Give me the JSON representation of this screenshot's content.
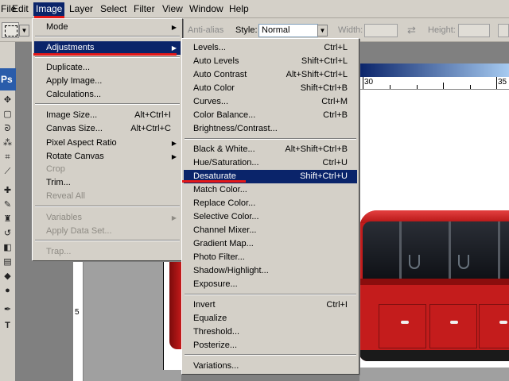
{
  "menubar": {
    "items": [
      "File",
      "Edit",
      "Image",
      "Layer",
      "Select",
      "Filter",
      "View",
      "Window",
      "Help"
    ],
    "active": "Image"
  },
  "options_bar": {
    "anti_alias_label": "Anti-alias",
    "style_label": "Style:",
    "style_value": "Normal",
    "width_label": "Width:",
    "height_label": "Height:"
  },
  "toolbox": {
    "logo_text": "Ps"
  },
  "rulers": {
    "top_numbers": [
      "30",
      "35"
    ],
    "left_numbers": [
      "5"
    ]
  },
  "image_menu": {
    "items": [
      {
        "label": "Mode",
        "submenu": true,
        "shortcut": "",
        "disabled": false
      },
      {
        "label": "Adjustments",
        "submenu": true,
        "shortcut": "",
        "disabled": false,
        "highlighted": true
      },
      {
        "label": "Duplicate...",
        "submenu": false,
        "shortcut": "",
        "disabled": false
      },
      {
        "label": "Apply Image...",
        "submenu": false,
        "shortcut": "",
        "disabled": false
      },
      {
        "label": "Calculations...",
        "submenu": false,
        "shortcut": "",
        "disabled": false
      },
      {
        "label": "Image Size...",
        "submenu": false,
        "shortcut": "Alt+Ctrl+I",
        "disabled": false
      },
      {
        "label": "Canvas Size...",
        "submenu": false,
        "shortcut": "Alt+Ctrl+C",
        "disabled": false
      },
      {
        "label": "Pixel Aspect Ratio",
        "submenu": true,
        "shortcut": "",
        "disabled": false
      },
      {
        "label": "Rotate Canvas",
        "submenu": true,
        "shortcut": "",
        "disabled": false
      },
      {
        "label": "Crop",
        "submenu": false,
        "shortcut": "",
        "disabled": true
      },
      {
        "label": "Trim...",
        "submenu": false,
        "shortcut": "",
        "disabled": false
      },
      {
        "label": "Reveal All",
        "submenu": false,
        "shortcut": "",
        "disabled": true
      },
      {
        "label": "Variables",
        "submenu": true,
        "shortcut": "",
        "disabled": true
      },
      {
        "label": "Apply Data Set...",
        "submenu": false,
        "shortcut": "",
        "disabled": true
      },
      {
        "label": "Trap...",
        "submenu": false,
        "shortcut": "",
        "disabled": true
      }
    ]
  },
  "adjustments_menu": {
    "items": [
      {
        "label": "Levels...",
        "shortcut": "Ctrl+L"
      },
      {
        "label": "Auto Levels",
        "shortcut": "Shift+Ctrl+L"
      },
      {
        "label": "Auto Contrast",
        "shortcut": "Alt+Shift+Ctrl+L"
      },
      {
        "label": "Auto Color",
        "shortcut": "Shift+Ctrl+B"
      },
      {
        "label": "Curves...",
        "shortcut": "Ctrl+M"
      },
      {
        "label": "Color Balance...",
        "shortcut": "Ctrl+B"
      },
      {
        "label": "Brightness/Contrast...",
        "shortcut": ""
      },
      {
        "label": "Black & White...",
        "shortcut": "Alt+Shift+Ctrl+B"
      },
      {
        "label": "Hue/Saturation...",
        "shortcut": "Ctrl+U"
      },
      {
        "label": "Desaturate",
        "shortcut": "Shift+Ctrl+U",
        "highlighted": true
      },
      {
        "label": "Match Color...",
        "shortcut": ""
      },
      {
        "label": "Replace Color...",
        "shortcut": ""
      },
      {
        "label": "Selective Color...",
        "shortcut": ""
      },
      {
        "label": "Channel Mixer...",
        "shortcut": ""
      },
      {
        "label": "Gradient Map...",
        "shortcut": ""
      },
      {
        "label": "Photo Filter...",
        "shortcut": ""
      },
      {
        "label": "Shadow/Highlight...",
        "shortcut": ""
      },
      {
        "label": "Exposure...",
        "shortcut": ""
      },
      {
        "label": "Invert",
        "shortcut": "Ctrl+I"
      },
      {
        "label": "Equalize",
        "shortcut": ""
      },
      {
        "label": "Threshold...",
        "shortcut": ""
      },
      {
        "label": "Posterize...",
        "shortcut": ""
      },
      {
        "label": "Variations...",
        "shortcut": ""
      }
    ]
  },
  "colors": {
    "highlight": "#0a246a",
    "annotation_underline": "#e41818",
    "menu_bg": "#d4d0c8"
  }
}
